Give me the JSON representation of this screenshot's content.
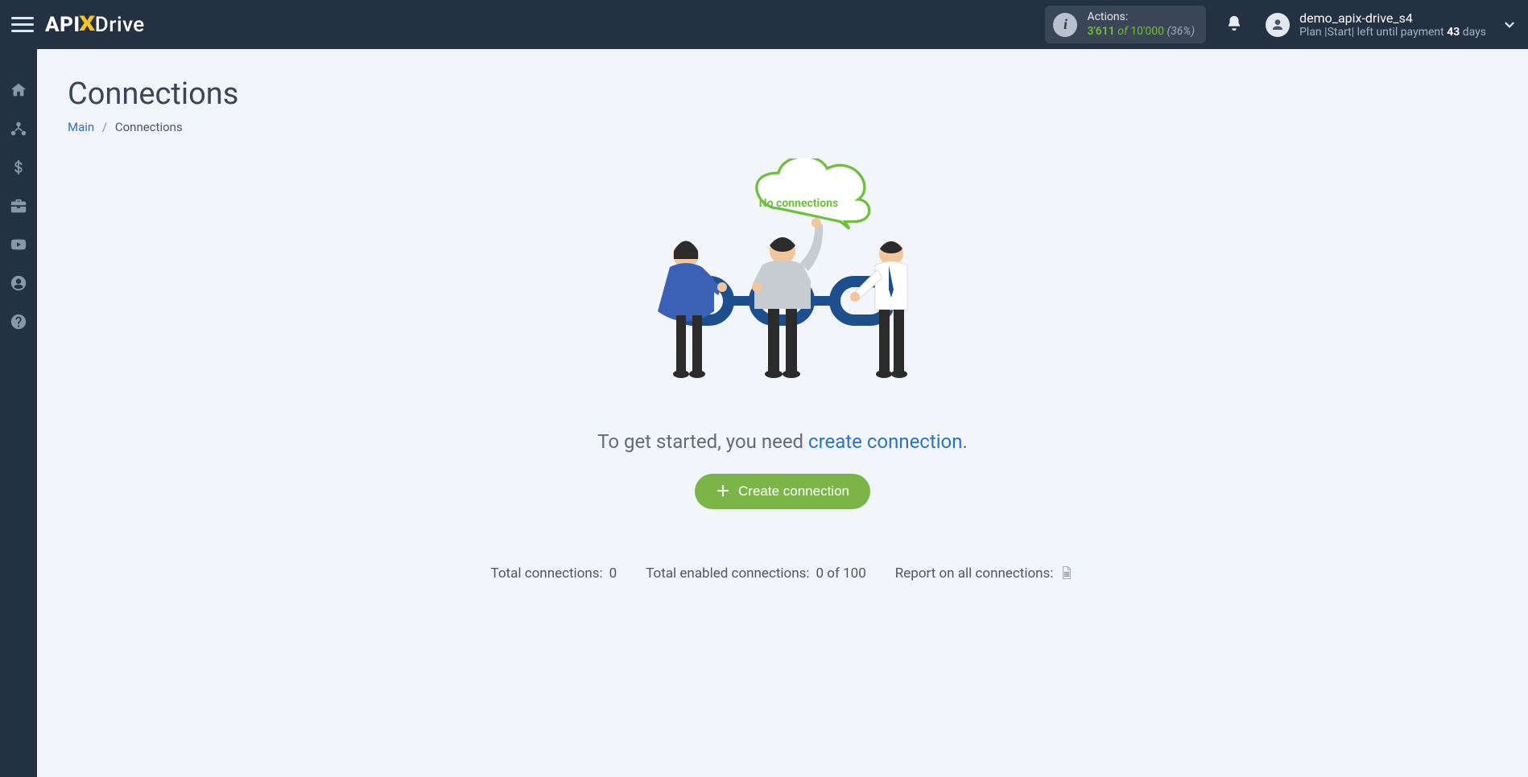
{
  "header": {
    "logo_api": "API",
    "logo_x": "X",
    "logo_drive": "Drive",
    "actions": {
      "label": "Actions:",
      "used": "3'611",
      "of": "of",
      "total": "10'000",
      "percent": "(36%)"
    },
    "user": {
      "name": "demo_apix-drive_s4",
      "plan_prefix": "Plan |",
      "plan_name": "Start",
      "plan_mid": "| left until payment ",
      "days": "43",
      "plan_suffix": " days"
    }
  },
  "sidebar": {
    "items": [
      {
        "name": "home"
      },
      {
        "name": "connections"
      },
      {
        "name": "billing"
      },
      {
        "name": "briefcase"
      },
      {
        "name": "youtube"
      },
      {
        "name": "account"
      },
      {
        "name": "help"
      }
    ]
  },
  "page": {
    "title": "Connections",
    "breadcrumb": {
      "main": "Main",
      "current": "Connections"
    }
  },
  "empty": {
    "cloud_text": "No connections",
    "lead_prefix": "To get started, you need ",
    "lead_link": "create connection",
    "lead_suffix": ".",
    "cta": "Create connection"
  },
  "stats": {
    "total_label": "Total connections:",
    "total_value": "0",
    "enabled_label": "Total enabled connections:",
    "enabled_value": "0 of 100",
    "report_label": "Report on all connections:"
  }
}
